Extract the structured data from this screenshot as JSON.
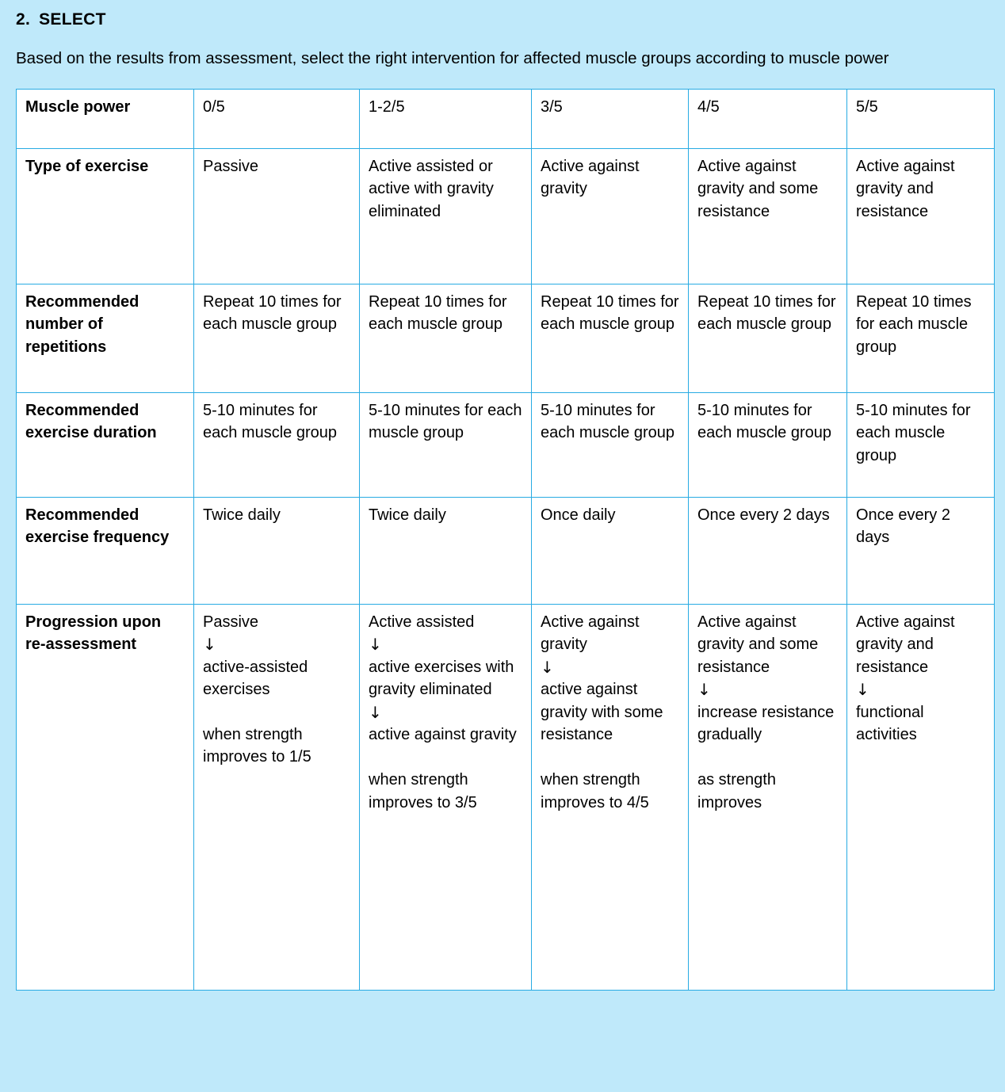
{
  "section": {
    "number": "2.",
    "title": "SELECT",
    "intro": "Based on the results from assessment, select the right intervention for affected muscle groups according to muscle power"
  },
  "colors": {
    "background": "#bfe9fa",
    "border": "#28abe3",
    "cell_background": "#ffffff",
    "text": "#000000"
  },
  "table": {
    "header": {
      "row_label": "Muscle power",
      "columns": [
        "0/5",
        "1-2/5",
        "3/5",
        "4/5",
        "5/5"
      ]
    },
    "rows": [
      {
        "label": "Type of exercise",
        "cells": [
          "Passive",
          "Active assisted or active with gravity eliminated",
          "Active against gravity",
          "Active against gravity and some resistance",
          "Active against gravity and resistance"
        ]
      },
      {
        "label": "Recommended number of repetitions",
        "cells": [
          "Repeat 10 times for each muscle group",
          "Repeat 10 times for each muscle group",
          "Repeat 10 times for each muscle group",
          "Repeat 10 times for each muscle group",
          "Repeat 10 times for each muscle group"
        ]
      },
      {
        "label": "Recommended exercise duration",
        "cells": [
          "5-10 minutes for each muscle group",
          "5-10 minutes for each muscle group",
          "5-10 minutes for each muscle group",
          "5-10 minutes for each muscle group",
          "5-10 minutes for each muscle group"
        ]
      },
      {
        "label": "Recommended exercise frequency",
        "cells": [
          "Twice daily",
          "Twice daily",
          "Once daily",
          "Once every 2 days",
          "Once every 2 days"
        ]
      }
    ],
    "progression": {
      "label": "Progression upon re-assessment",
      "arrow_glyph": "↓",
      "columns": [
        {
          "start": "Passive",
          "steps": [
            "active-assisted exercises"
          ],
          "condition": "when strength improves to 1/5"
        },
        {
          "start": "Active assisted",
          "steps": [
            "active exercises with gravity eliminated",
            "active against gravity"
          ],
          "condition": "when strength improves to 3/5"
        },
        {
          "start": "Active against gravity",
          "steps": [
            " active against gravity with some resistance"
          ],
          "condition": "when strength improves to 4/5"
        },
        {
          "start": "Active against gravity and some resistance",
          "steps": [
            "increase resistance gradually"
          ],
          "condition": "as strength improves"
        },
        {
          "start": "Active against gravity and resistance",
          "steps": [
            " functional activities"
          ],
          "condition": ""
        }
      ]
    }
  }
}
